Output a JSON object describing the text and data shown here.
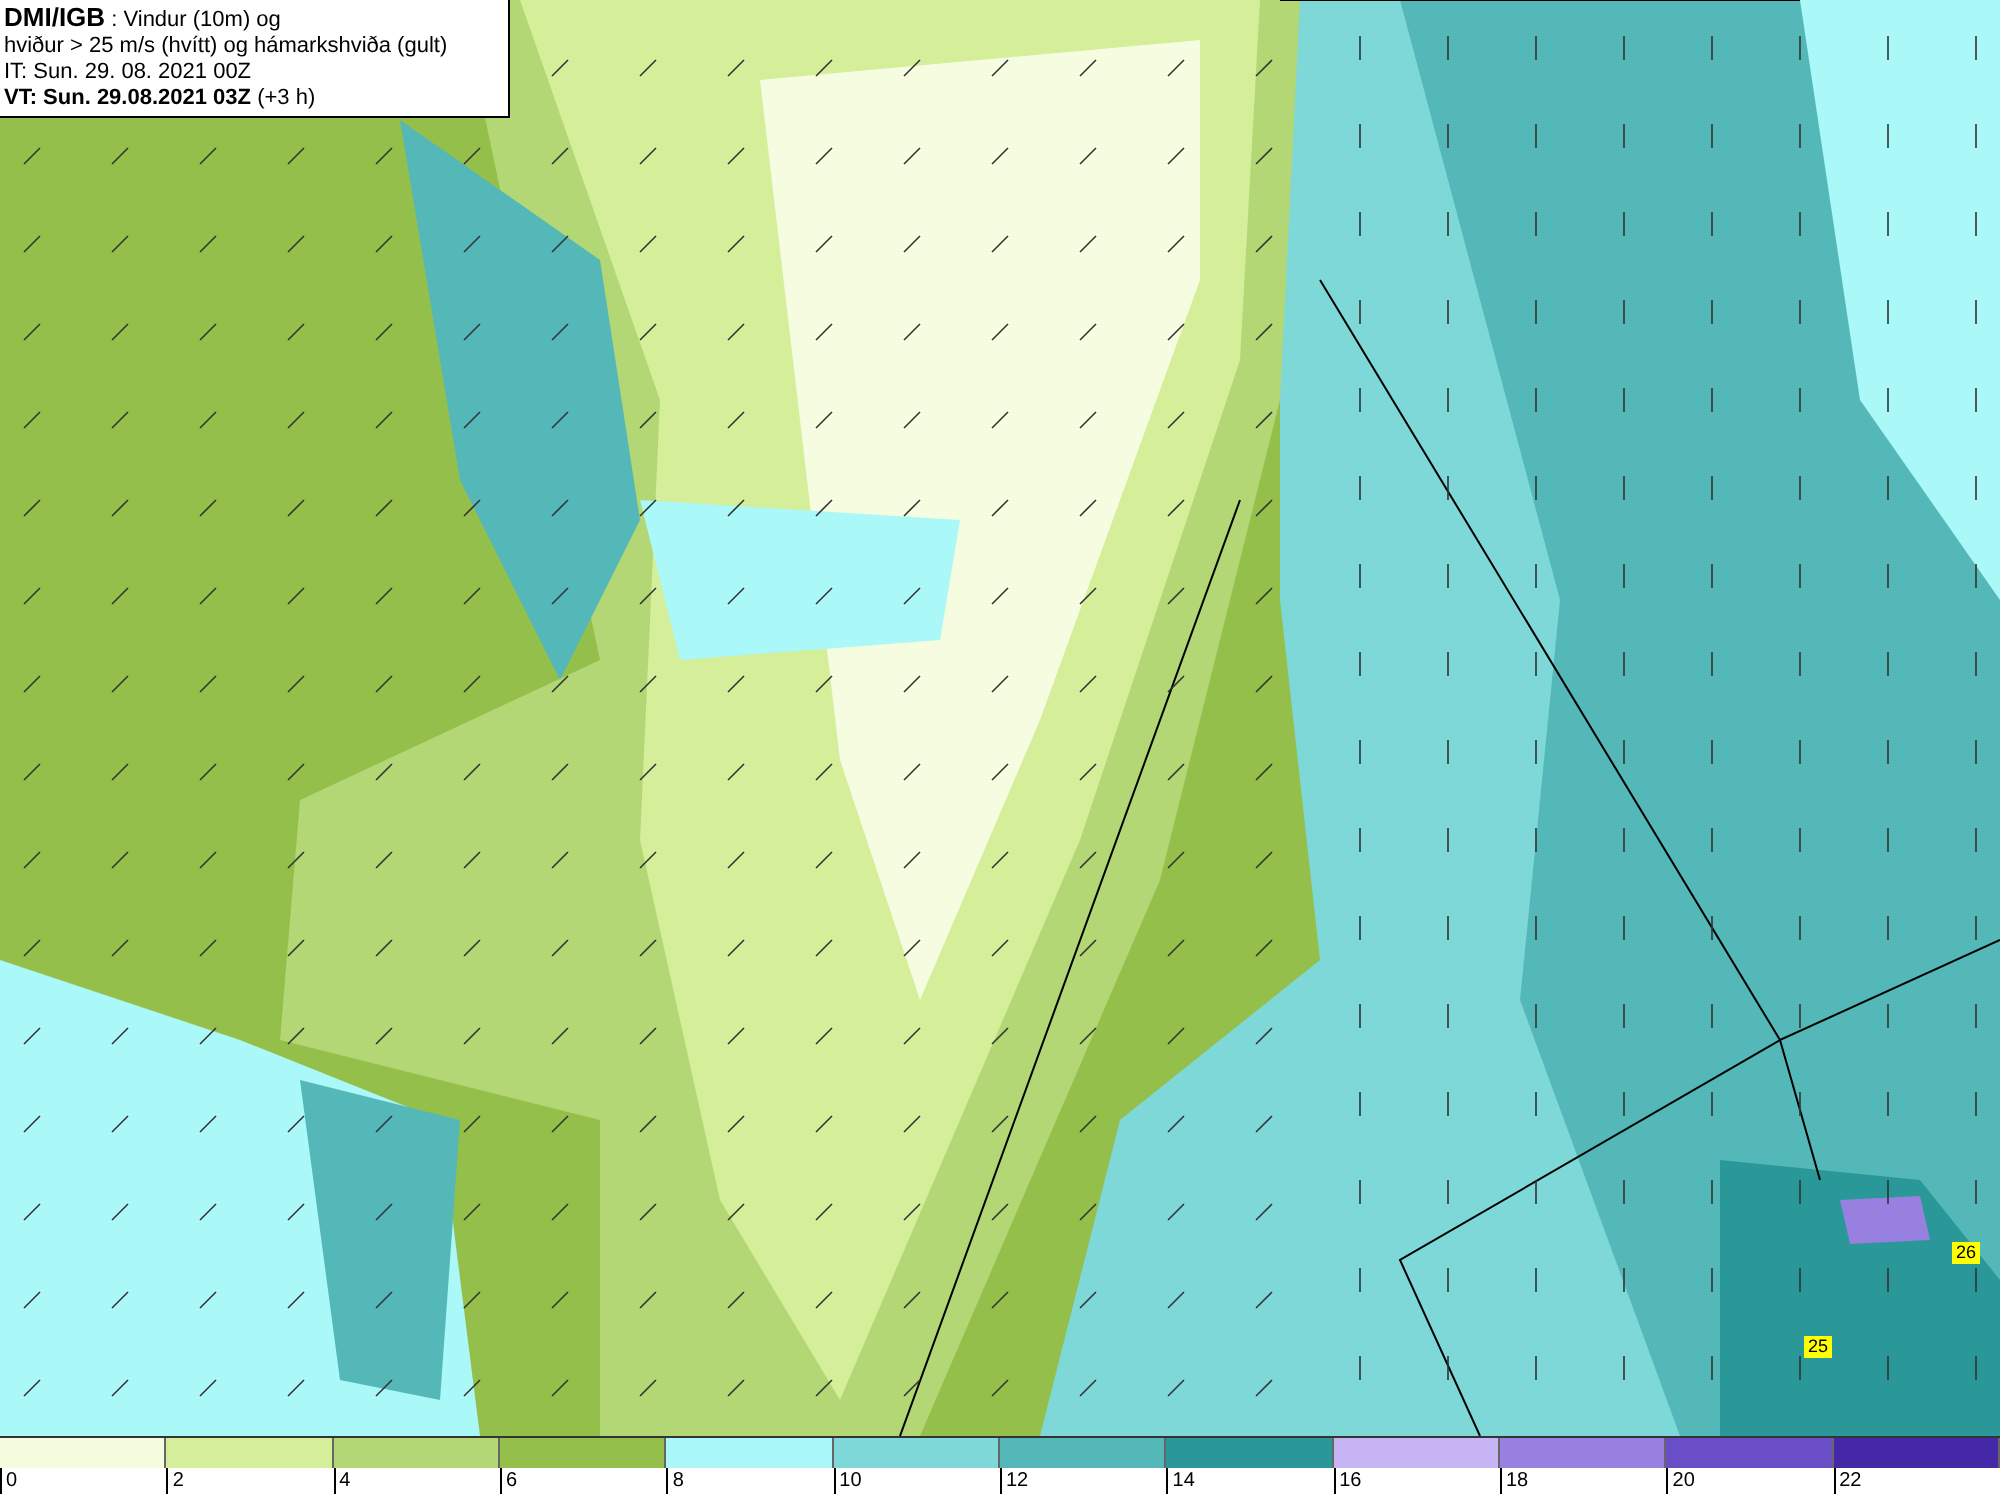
{
  "info_box": {
    "source": "DMI/IGB",
    "title": ": Vindur (10m) og",
    "subtitle": "hviður > 25 m/s (hvítt) og hámarkshviða (gult)",
    "it_line": "IT: Sun. 29. 08. 2021 00Z",
    "vt_line": "VT: Sun. 29.08.2021 03Z",
    "vt_offset": "(+3 h)"
  },
  "map": {
    "gust_labels": [
      {
        "label": "26"
      },
      {
        "label": "25"
      }
    ]
  },
  "legend": {
    "bins": [
      {
        "label": "0",
        "color": "#f5fce0"
      },
      {
        "label": "2",
        "color": "#d4ee9a"
      },
      {
        "label": "4",
        "color": "#b2d774"
      },
      {
        "label": "6",
        "color": "#93bf4a"
      },
      {
        "label": "8",
        "color": "#aaf8f8"
      },
      {
        "label": "10",
        "color": "#7fd8d8"
      },
      {
        "label": "12",
        "color": "#55b8b8"
      },
      {
        "label": "14",
        "color": "#2a9898"
      },
      {
        "label": "16",
        "color": "#c6b4f4"
      },
      {
        "label": "18",
        "color": "#9880e0"
      },
      {
        "label": "20",
        "color": "#6a4ec8"
      },
      {
        "label": "22",
        "color": "#4428a8"
      }
    ]
  }
}
